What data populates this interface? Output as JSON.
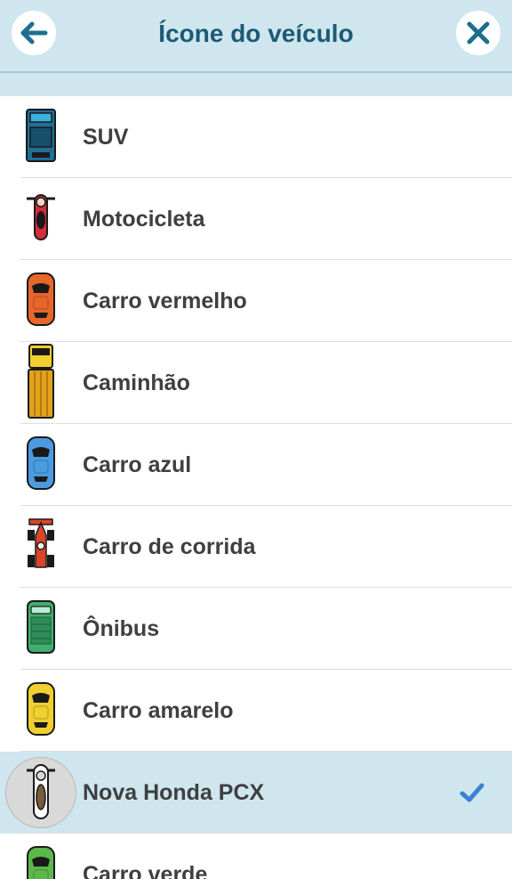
{
  "header": {
    "title": "Ícone do veículo",
    "back_icon": "arrow-left-icon",
    "close_icon": "close-icon"
  },
  "colors": {
    "header_bg": "#cfe6ef",
    "title": "#1c5b73",
    "selected_bg": "#cfe6ef",
    "check": "#3b82d6"
  },
  "vehicles": [
    {
      "label": "SUV",
      "icon": "suv-icon",
      "color": "#1f6f96"
    },
    {
      "label": "Motocicleta",
      "icon": "motorcycle-icon",
      "color": "#d62b3a"
    },
    {
      "label": "Carro vermelho",
      "icon": "red-car-icon",
      "color": "#e8662a"
    },
    {
      "label": "Caminhão",
      "icon": "truck-icon",
      "color": "#e3a21a"
    },
    {
      "label": "Carro azul",
      "icon": "blue-car-icon",
      "color": "#4a9be0"
    },
    {
      "label": "Carro de corrida",
      "icon": "race-car-icon",
      "color": "#d9452a"
    },
    {
      "label": "Ônibus",
      "icon": "bus-icon",
      "color": "#3fae6e"
    },
    {
      "label": "Carro amarelo",
      "icon": "yellow-car-icon",
      "color": "#f0cf2e"
    },
    {
      "label": "Nova Honda PCX",
      "icon": "scooter-icon",
      "color": "#ffffff",
      "selected": true
    },
    {
      "label": "Carro verde",
      "icon": "green-car-icon",
      "color": "#5cb84a"
    }
  ]
}
